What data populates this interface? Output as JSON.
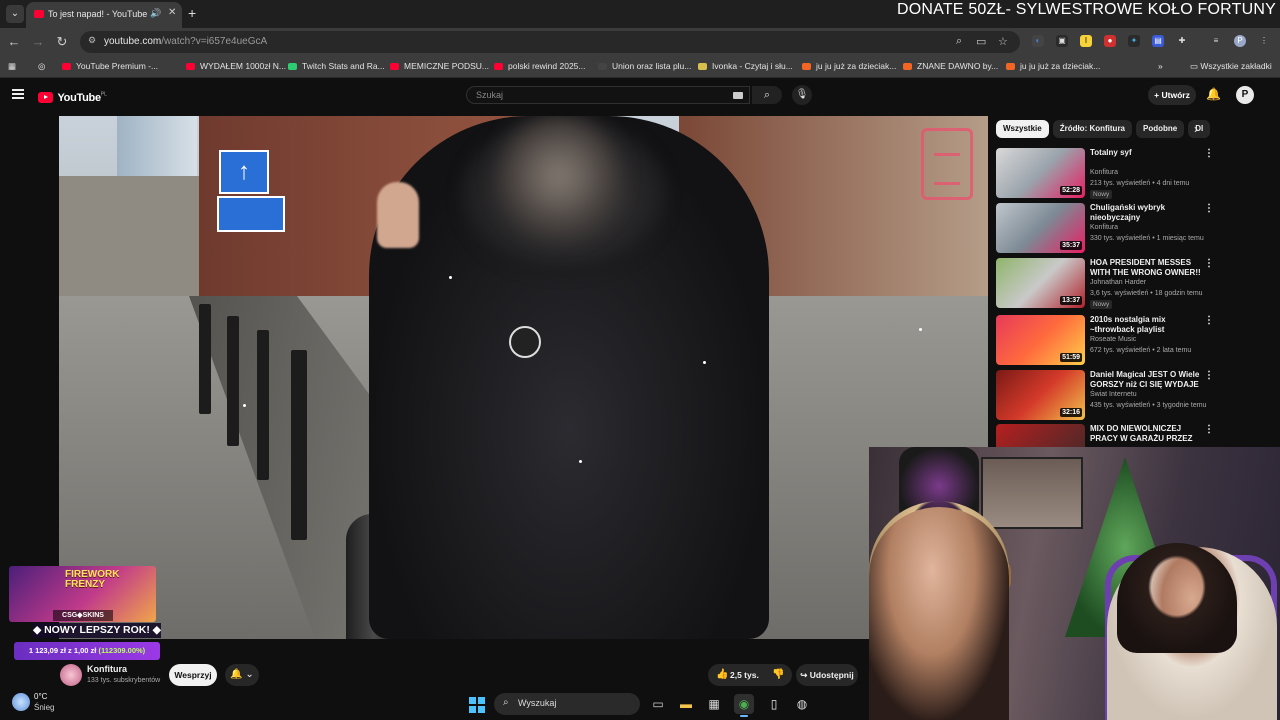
{
  "browser": {
    "tab_title": "To jest napad! - YouTube",
    "url_host": "youtube.com",
    "url_path": "/watch?v=i657e4ueGcA",
    "overlay_banner": "DONATE 50ZŁ- SYLWESTROWE KOŁO FORTUNY"
  },
  "bookmarks": [
    {
      "label": "YouTube Premium -...",
      "color": "#ff0033"
    },
    {
      "label": "WYDAŁEM 1000zł N...",
      "color": "#ff0033"
    },
    {
      "label": "Twitch Stats and Ra...",
      "color": "#2ecc71"
    },
    {
      "label": "MEMICZNE PODSU...",
      "color": "#ff0033"
    },
    {
      "label": "polski rewind 2025...",
      "color": "#ff0033"
    },
    {
      "label": "Union oraz lista plu...",
      "color": "#444444"
    },
    {
      "label": "Ivonka - Czytaj i słu...",
      "color": "#d8c04a"
    },
    {
      "label": "ju ju już za dzieciak...",
      "color": "#f26522"
    },
    {
      "label": "ZNANE DAWNO by...",
      "color": "#f26522"
    },
    {
      "label": "ju ju już za dzieciak...",
      "color": "#f26522"
    }
  ],
  "all_bookmarks_label": "Wszystkie zakładki",
  "youtube": {
    "logo_text": "YouTube",
    "logo_region": "PL",
    "search_placeholder": "Szukaj",
    "create_label": "Utwórz",
    "avatar_letter": "P"
  },
  "recs": {
    "chips": [
      "Wszystkie",
      "Źródło: Konfitura",
      "Podobne",
      "Dl"
    ],
    "items": [
      {
        "title": "Totalny syf",
        "channel": "Konfitura",
        "meta": "213 tys. wyświetleń • 4 dni temu",
        "duration": "52:28",
        "badge": "Nowy",
        "thumb": "linear-gradient(135deg,#d9d9d9,#9aa3ab 50%,#e91e63)"
      },
      {
        "title": "Chuligański wybryk nieobyczajny",
        "channel": "Konfitura",
        "meta": "330 tys. wyświetleń • 1 miesiąc temu",
        "duration": "35:37",
        "badge": "",
        "thumb": "linear-gradient(135deg,#c0c6cc,#7d8a95 50%,#e91e63)"
      },
      {
        "title": "HOA PRESIDENT MESSES WITH THE WRONG OWNER!! (Full ...",
        "channel": "Johnathan Harder",
        "meta": "3,6 tys. wyświetleń • 18 godzin temu",
        "duration": "13:37",
        "badge": "Nowy",
        "thumb": "linear-gradient(135deg,#8fb56a,#c9c9c9 50%,#b0202a)"
      },
      {
        "title": "2010s nostalgia mix ~throwback playlist",
        "channel": "Roseate Music",
        "meta": "672 tys. wyświetleń • 2 lata temu",
        "duration": "51:59",
        "badge": "",
        "thumb": "linear-gradient(135deg,#e63a5a,#ff6a3d 50%,#ffcf4a)"
      },
      {
        "title": "Daniel Magical JEST O Wiele GORSZY niż CI SIĘ WYDAJE",
        "channel": "Świat Internetu",
        "meta": "435 tys. wyświetleń • 3 tygodnie temu",
        "duration": "32:16",
        "badge": "",
        "thumb": "linear-gradient(135deg,#7a1a16,#d43a2a 50%,#f2c14a)"
      },
      {
        "title": "MIX DO NIEWOLNICZEJ PRACY W GARAŻU PRZEZ 12H ZA ...",
        "channel": "",
        "meta": "",
        "duration": "",
        "badge": "",
        "thumb": "linear-gradient(135deg,#b51f1f,#3a2a2a)"
      }
    ]
  },
  "channel": {
    "name": "Konfitura",
    "subs": "133 tys. subskrybentów",
    "support_label": "Wesprzyj",
    "likes": "2,5 tys.",
    "share_label": "Udostępnij"
  },
  "stream": {
    "promo_title_1": "FIREWORK",
    "promo_title_2": "FRENZY",
    "promo_brand": "CSG◆SKINS",
    "new_year": "◆ NOWY LEPSZY ROK! ◆",
    "ticker_amount": "1 123,09 zł z 1,00 zł",
    "ticker_pct": "(112309.00%)"
  },
  "taskbar": {
    "temp": "0°C",
    "weather": "Śnieg",
    "search_label": "Wyszukaj"
  }
}
